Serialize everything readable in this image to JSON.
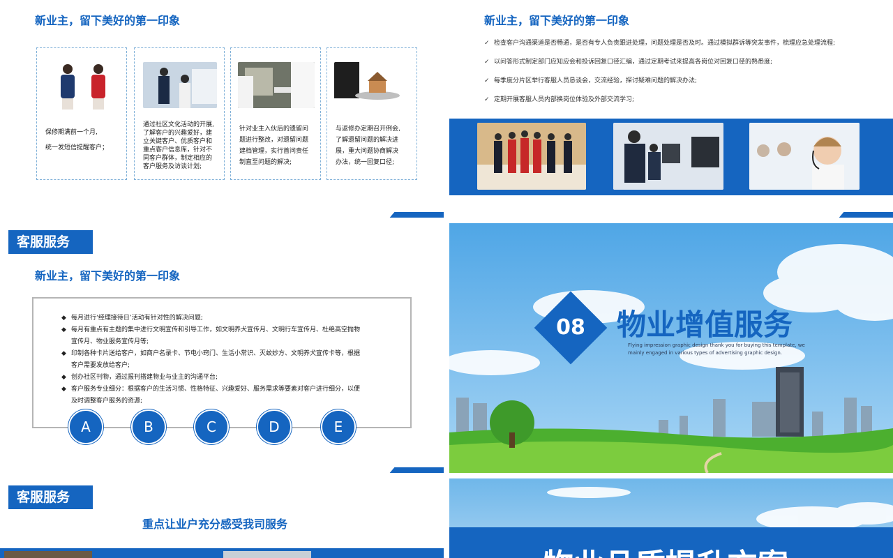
{
  "slide_tl": {
    "heading": "新业主，留下美好的第一印象",
    "cards": [
      {
        "text_lines": [
          "保修期满前一个月,",
          "统一发短信提醒客户；"
        ]
      },
      {
        "text_lines": [
          "通过社区文化活动的开展,",
          "了解客户的兴趣爱好，建",
          "立关键客户、优质客户和",
          "重点客户信息库，针对不",
          "同客户群体，制定相应的",
          "客户服务及访谈计划;"
        ]
      },
      {
        "text_lines": [
          "针对业主入伙后的遗留问",
          "题进行整改，对遗留问题",
          "建档管理，实行首问责任",
          "制直至问题的解决;"
        ]
      },
      {
        "text_lines": [
          "与返修办定期召开例会,",
          "了解遗留问题的解决进",
          "展，重大问题协商解决",
          "办法，统一回复口径;"
        ]
      }
    ]
  },
  "slide_tr": {
    "heading": "新业主，留下美好的第一印象",
    "checks": [
      "检查客户沟通渠道是否畅通，是否有专人负责跟进处理，问题处理是否及时。通过模拟群诉等突发事件，梳理应急处理流程;",
      "以问答形式制定部门应知应会和投诉回复口径汇编，通过定期考试来提高各岗位对回复口径的熟悉度;",
      "每季度分片区举行客服人员恳谈会，交流经验，探讨疑难问题的解决办法;",
      "定期开展客服人员内部换岗位体验及外部交流学习;"
    ],
    "check_mark": "✓"
  },
  "slide_ml": {
    "tag": "客服服务",
    "heading": "新业主，留下美好的第一印象",
    "bullet_mark": "◆",
    "bullets": [
      [
        "每月进行‘经理接待日’活动有针对性的解决问题;"
      ],
      [
        "每月有重点有主题的集中进行文明宣传和引导工作，如文明养犬宣传月、文明行车宣传月、杜绝高空抛物",
        "宣传月、物业服务宣传月等;"
      ],
      [
        "印制各种卡片送给客户，如商户名录卡、节电小窍门、生活小常识、灭蚊妙方、文明养犬宣传卡等，根据",
        "客户需要发放给客户;"
      ],
      [
        "创办社区刊物，通过报刊搭建物业与业主的沟通平台;"
      ],
      [
        "客户服务专业细分：根据客户的生活习惯、性格特征、兴趣爱好、服务需求等要素对客户进行细分，以便",
        "及时调整客户服务的资源;"
      ]
    ],
    "circles": [
      "A",
      "B",
      "C",
      "D",
      "E"
    ]
  },
  "slide_mr": {
    "number": "08",
    "title": "物业增值服务",
    "subtitle_lines": [
      "Flying impression graphic design thank you for buying this template, we",
      "mainly engaged in various types of advertising graphic design."
    ]
  },
  "slide_bl": {
    "tag": "客服服务",
    "heading": "重点让业户充分感受我司服务"
  },
  "slide_br": {
    "title": "物业品质提升方案"
  },
  "colors": {
    "accent": "#1565c0",
    "sky": "#62b3ea",
    "grass": "#4caf2f"
  }
}
